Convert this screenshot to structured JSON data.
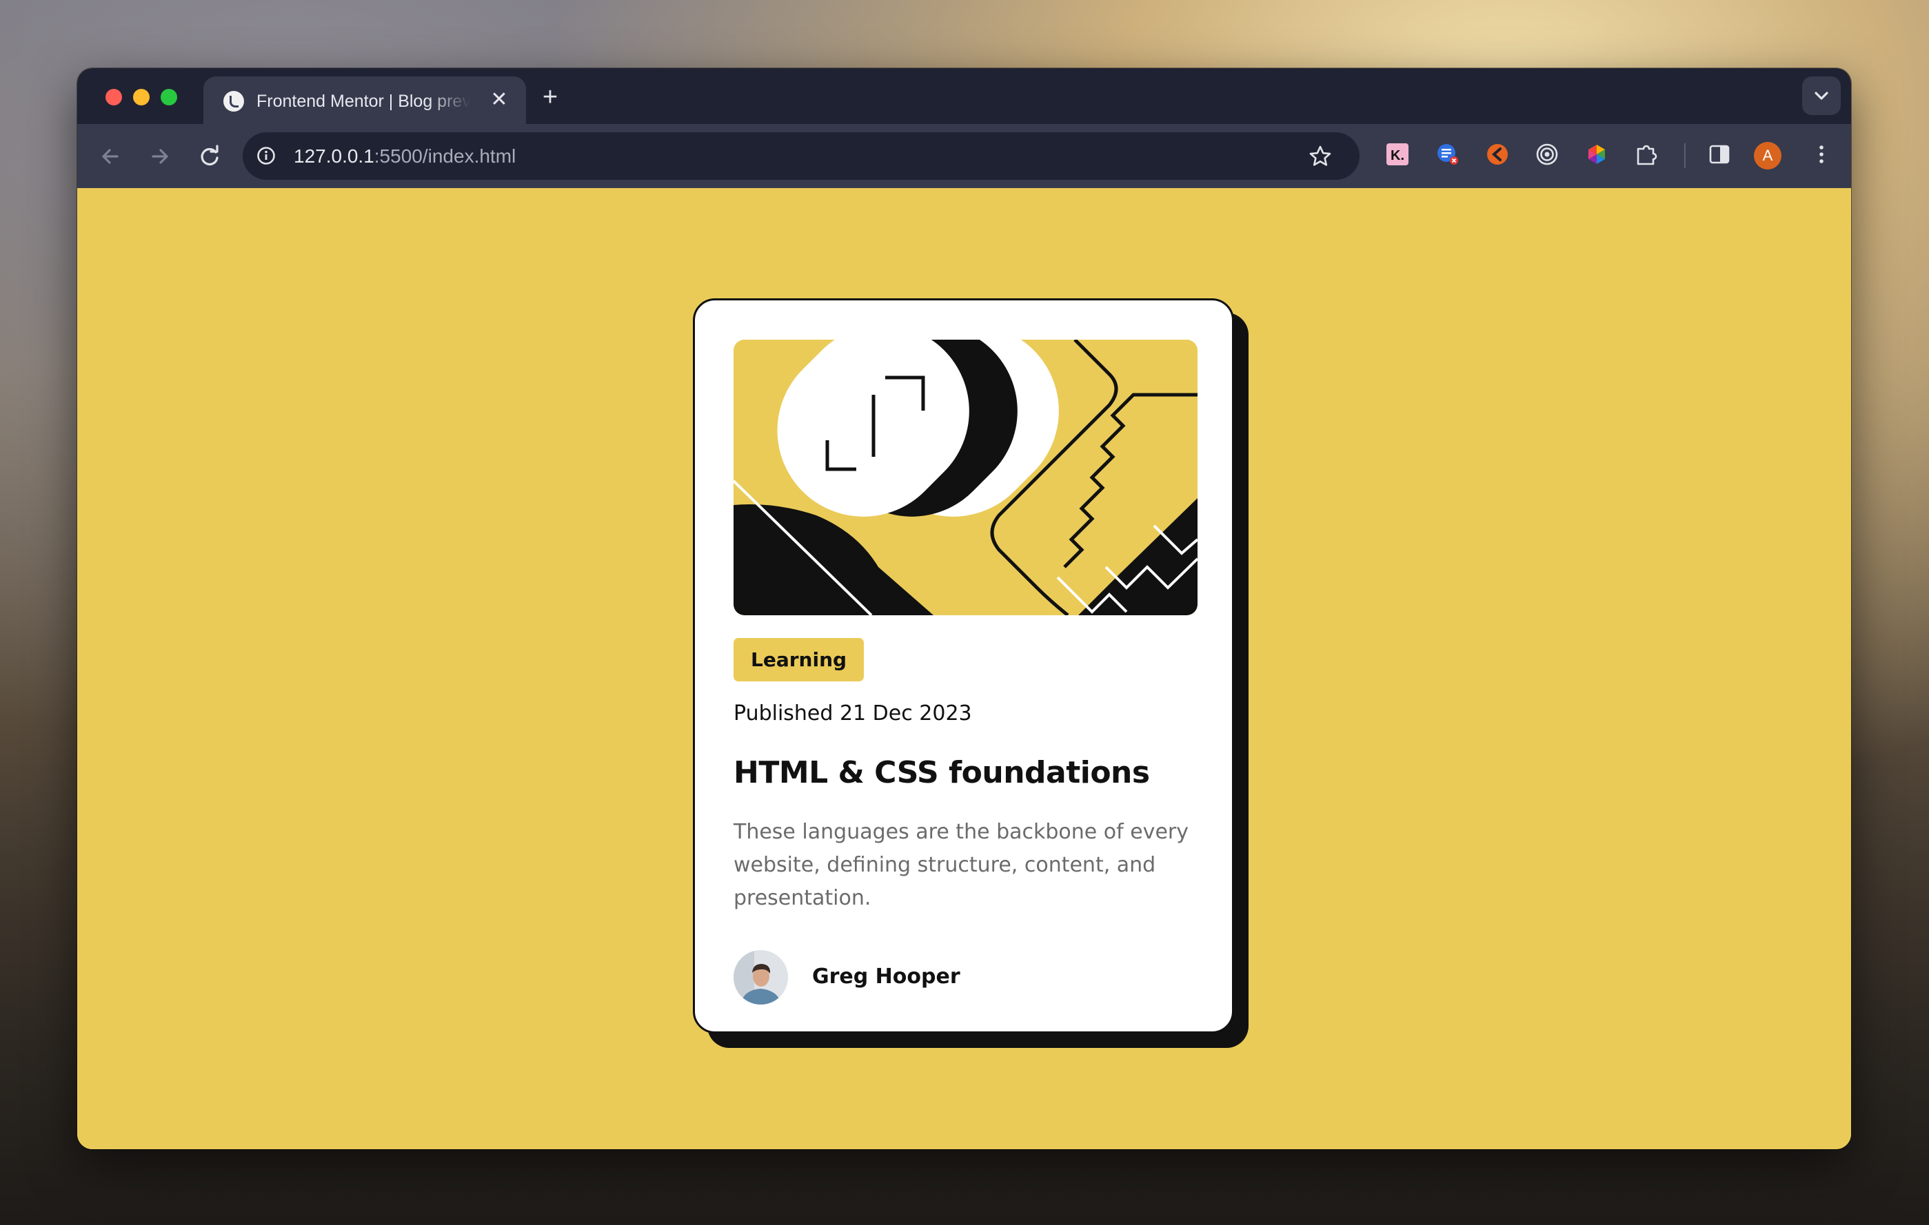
{
  "browser": {
    "tab": {
      "title": "Frontend Mentor | Blog preview card",
      "close_glyph": "✕"
    },
    "new_tab_glyph": "+",
    "address": {
      "host": "127.0.0.1",
      "port_path": ":5500/index.html"
    },
    "profile_initial": "A",
    "icons": [
      "back-icon",
      "forward-icon",
      "reload-icon",
      "site-info-icon",
      "bookmark-star-icon",
      "klarna-extension-icon",
      "list-extension-icon",
      "orange-extension-icon",
      "target-extension-icon",
      "color-extension-icon",
      "puzzle-extensions-icon",
      "side-panel-icon",
      "profile-avatar",
      "more-menu-icon",
      "tab-search-icon"
    ]
  },
  "card": {
    "tag": "Learning",
    "published": "Published 21 Dec 2023",
    "title": "HTML & CSS foundations",
    "description": "These languages are the backbone of every website, defining structure, content, and presentation.",
    "author": "Greg Hooper"
  },
  "colors": {
    "page_background": "#eacb58",
    "card_background": "#ffffff",
    "ink": "#111111",
    "muted_text": "#6b6b6b",
    "browser_chrome": "#1f2232",
    "browser_toolbar": "#363a4c"
  }
}
